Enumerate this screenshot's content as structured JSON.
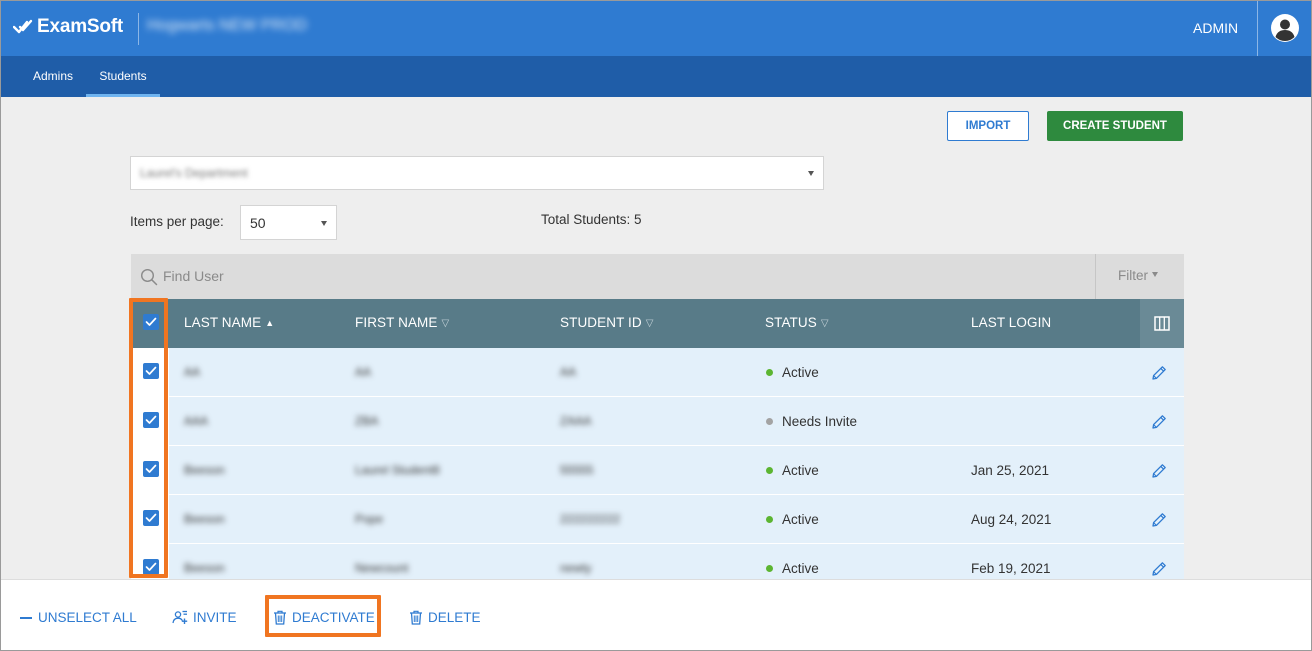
{
  "header": {
    "logo_text": "ExamSoft",
    "institution_name": "Hogwarts NEW PROD",
    "user_label": "ADMIN"
  },
  "nav": {
    "tabs": [
      {
        "label": "Admins",
        "active": false
      },
      {
        "label": "Students",
        "active": true
      }
    ]
  },
  "toolbar": {
    "import_label": "IMPORT",
    "create_label": "CREATE STUDENT"
  },
  "department_select": {
    "value": "Laurel's Department"
  },
  "pagination": {
    "items_label": "Items per page:",
    "items_value": "50",
    "total_text": "Total Students: 5"
  },
  "search": {
    "placeholder": "Find User",
    "filter_label": "Filter"
  },
  "table": {
    "headers": {
      "last_name": "LAST NAME",
      "first_name": "FIRST NAME",
      "student_id": "STUDENT ID",
      "status": "STATUS",
      "last_login": "LAST LOGIN"
    },
    "rows": [
      {
        "last_name": "AA",
        "first_name": "AA",
        "student_id": "AA",
        "status": "Active",
        "status_color": "#5cb531",
        "last_login": ""
      },
      {
        "last_name": "AAA",
        "first_name": "ZBA",
        "student_id": "ZAAA",
        "status": "Needs Invite",
        "status_color": "#a3a3a3",
        "last_login": ""
      },
      {
        "last_name": "Beeson",
        "first_name": "Laurel Student8",
        "student_id": "55555",
        "status": "Active",
        "status_color": "#5cb531",
        "last_login": "Jan 25, 2021"
      },
      {
        "last_name": "Beeson",
        "first_name": "Pope",
        "student_id": "222222222",
        "status": "Active",
        "status_color": "#5cb531",
        "last_login": "Aug 24, 2021"
      },
      {
        "last_name": "Beeson",
        "first_name": "Newcount",
        "student_id": "newty",
        "status": "Active",
        "status_color": "#5cb531",
        "last_login": "Feb 19, 2021"
      }
    ]
  },
  "bulk_actions": {
    "unselect_all": "UNSELECT ALL",
    "invite": "INVITE",
    "deactivate": "DEACTIVATE",
    "delete": "DELETE"
  },
  "colors": {
    "primary_blue": "#2f7bd1",
    "nav_blue": "#1f5da8",
    "create_green": "#2e8a3e",
    "table_header": "#587b88",
    "highlight_orange": "#f07521"
  }
}
